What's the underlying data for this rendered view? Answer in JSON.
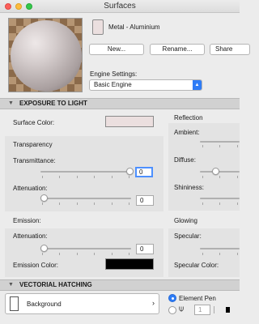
{
  "window": {
    "title": "Surfaces"
  },
  "material": {
    "name": "Metal - Aluminium",
    "swatch_color": "#ebdfdf"
  },
  "buttons": {
    "new": "New...",
    "rename": "Rename...",
    "share": "Share"
  },
  "engine": {
    "label": "Engine Settings:",
    "selected": "Basic Engine"
  },
  "sections": {
    "exposure": "EXPOSURE TO LIGHT",
    "hatching": "VECTORIAL HATCHING"
  },
  "exposure": {
    "surface_color_label": "Surface Color:",
    "surface_color": "#ebdfdf",
    "transparency_header": "Transparency",
    "transmittance_label": "Transmittance:",
    "transmittance_value": "0",
    "attenuation_label": "Attenuation:",
    "attenuation_value": "0",
    "emission_header": "Emission:",
    "emission_attenuation_label": "Attenuation:",
    "emission_attenuation_value": "0",
    "emission_color_label": "Emission Color:",
    "emission_color": "#000000"
  },
  "reflection": {
    "header": "Reflection",
    "ambient_label": "Ambient:",
    "diffuse_label": "Diffuse:",
    "shininess_label": "Shininess:",
    "glowing_header": "Glowing",
    "specular_label": "Specular:",
    "specular_color_label": "Specular Color:"
  },
  "hatching": {
    "background_label": "Background",
    "element_pen_label": "Element Pen",
    "pen_value": "1"
  }
}
